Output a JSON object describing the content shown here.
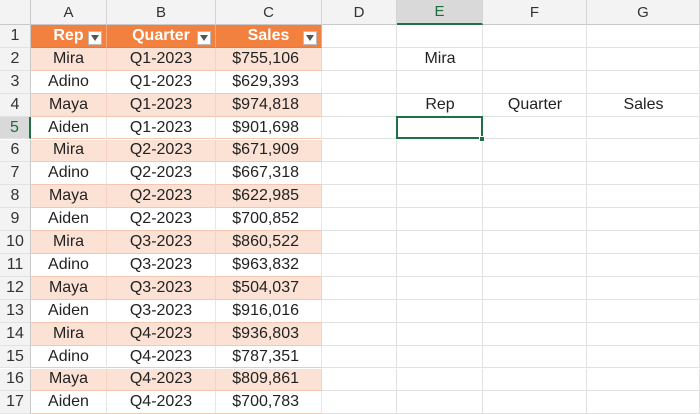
{
  "sheet": {
    "columns": [
      "A",
      "B",
      "C",
      "D",
      "E",
      "F",
      "G"
    ],
    "selected_column": "E",
    "rows": [
      "1",
      "2",
      "3",
      "4",
      "5",
      "6",
      "7",
      "8",
      "9",
      "10",
      "11",
      "12",
      "13",
      "14",
      "15",
      "16",
      "17"
    ],
    "selected_row": "5"
  },
  "table": {
    "headers": [
      "Rep",
      "Quarter",
      "Sales"
    ],
    "rows": [
      [
        "Mira",
        "Q1-2023",
        "$755,106"
      ],
      [
        "Adino",
        "Q1-2023",
        "$629,393"
      ],
      [
        "Maya",
        "Q1-2023",
        "$974,818"
      ],
      [
        "Aiden",
        "Q1-2023",
        "$901,698"
      ],
      [
        "Mira",
        "Q2-2023",
        "$671,909"
      ],
      [
        "Adino",
        "Q2-2023",
        "$667,318"
      ],
      [
        "Maya",
        "Q2-2023",
        "$622,985"
      ],
      [
        "Aiden",
        "Q2-2023",
        "$700,852"
      ],
      [
        "Mira",
        "Q3-2023",
        "$860,522"
      ],
      [
        "Adino",
        "Q3-2023",
        "$963,832"
      ],
      [
        "Maya",
        "Q3-2023",
        "$504,037"
      ],
      [
        "Aiden",
        "Q3-2023",
        "$916,016"
      ],
      [
        "Mira",
        "Q4-2023",
        "$936,803"
      ],
      [
        "Adino",
        "Q4-2023",
        "$787,351"
      ],
      [
        "Maya",
        "Q4-2023",
        "$809,861"
      ],
      [
        "Aiden",
        "Q4-2023",
        "$700,783"
      ]
    ]
  },
  "lookup": {
    "criteria_value": "Mira",
    "result_headers": [
      "Rep",
      "Quarter",
      "Sales"
    ]
  },
  "colors": {
    "header_fill": "#f2803f",
    "band_fill": "#fbe2d5",
    "selection": "#1e7145"
  }
}
